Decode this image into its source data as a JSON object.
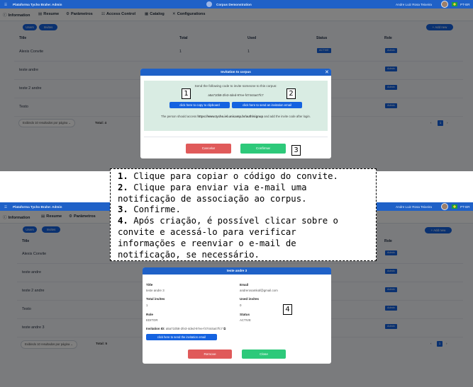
{
  "app": {
    "brand": "Plataforma Tycho Brahe: Admin",
    "corpus": "Corpus Demonstration",
    "user": "Andre Luiz Rosa Teixeira",
    "lang": "PT-BR"
  },
  "tabs": [
    {
      "icon": "ⓘ",
      "label": "Information"
    },
    {
      "icon": "▤",
      "label": "Resume"
    },
    {
      "icon": "⚙",
      "label": "Parâmetros"
    },
    {
      "icon": "☷",
      "label": "Access Control"
    },
    {
      "icon": "▦",
      "label": "Catalog"
    },
    {
      "icon": "✕",
      "label": "Configurations"
    }
  ],
  "subtabs": [
    "Users",
    "Invites"
  ],
  "add_new": "+ Add new",
  "columns": [
    "Title",
    "Total",
    "Used",
    "Status",
    "Role"
  ],
  "top_rows": [
    {
      "title": "Alexis Convite",
      "total": "1",
      "used": "1",
      "status": "ACTIVE",
      "role": "Admin"
    },
    {
      "title": "teste andre",
      "total": "",
      "used": "",
      "status": "",
      "role": "Admin"
    },
    {
      "title": "teste 2 andre",
      "total": "",
      "used": "",
      "status": "",
      "role": "Admin"
    },
    {
      "title": "Testo",
      "total": "",
      "used": "",
      "status": "",
      "role": "Admin"
    }
  ],
  "bottom_rows": [
    {
      "title": "Alexis Convite",
      "role": "Admin"
    },
    {
      "title": "teste andre",
      "role": "Admin"
    },
    {
      "title": "teste 2 andre",
      "role": "Admin"
    },
    {
      "title": "Testo",
      "role": "Admin"
    },
    {
      "title": "teste andre 3",
      "role": "Admin"
    }
  ],
  "pagination": {
    "per_page": "Exibindo 10 resultados por página",
    "total_top": "Total: 4",
    "total_bottom": "Total: 5",
    "page": "1"
  },
  "invite_modal": {
    "title": "Invitation to corpus",
    "intro": "Send the following code to invite someone to this corpus:",
    "code": "a5a710b8-2fe3-4ded-97ee-f47444a47fc7",
    "copy_button": "click here to copy to clipboard",
    "email_button": "click here to send an invitation email",
    "access_prefix": "The person should access ",
    "access_url": "https://www.tycho.iel.unicamp.br/auth/signup",
    "access_suffix": " and add the invite code after login.",
    "cancel": "Cancelar",
    "confirm": "Confirmar"
  },
  "detail_modal": {
    "title": "teste andre 3",
    "fields": [
      {
        "label": "Title",
        "value": "teste andre 3"
      },
      {
        "label": "Email",
        "value": "andrerosamkaf@gmail.com"
      },
      {
        "label": "Total invites",
        "value": "1"
      },
      {
        "label": "Used invites",
        "value": "0"
      },
      {
        "label": "Role",
        "value": "EDITOR"
      },
      {
        "label": "Status",
        "value": "ACTIVE"
      }
    ],
    "invitation_label": "Invitation ID:",
    "invitation_id": "a5a710b8-2fe3-4ded-97ee-f47444a47fc7",
    "send_button": "click here to send the invitation email",
    "remove": "Remove",
    "close": "Close"
  },
  "markers": [
    "1",
    "2",
    "3",
    "4"
  ],
  "note": {
    "items": [
      {
        "n": "1.",
        "text": " Clique para copiar o código do convite."
      },
      {
        "n": "2.",
        "text": " Clique para enviar via e-mail uma"
      },
      {
        "n": "",
        "text": "notificação de associação ao corpus."
      },
      {
        "n": "3.",
        "text": " Confirme."
      },
      {
        "n": "4.",
        "text": " Após criação, é possível clicar sobre o"
      },
      {
        "n": "",
        "text": "convite e acessá-lo para verificar"
      },
      {
        "n": "",
        "text": "informações e reenviar o e-mail de"
      },
      {
        "n": "",
        "text": "notificação, se necessário."
      }
    ]
  },
  "colors": {
    "primary": "#1f61c7",
    "button_blue": "#1462e0",
    "cancel_red": "#e05a5a",
    "confirm_green": "#2dc97a",
    "invite_box": "#d9ece3"
  }
}
